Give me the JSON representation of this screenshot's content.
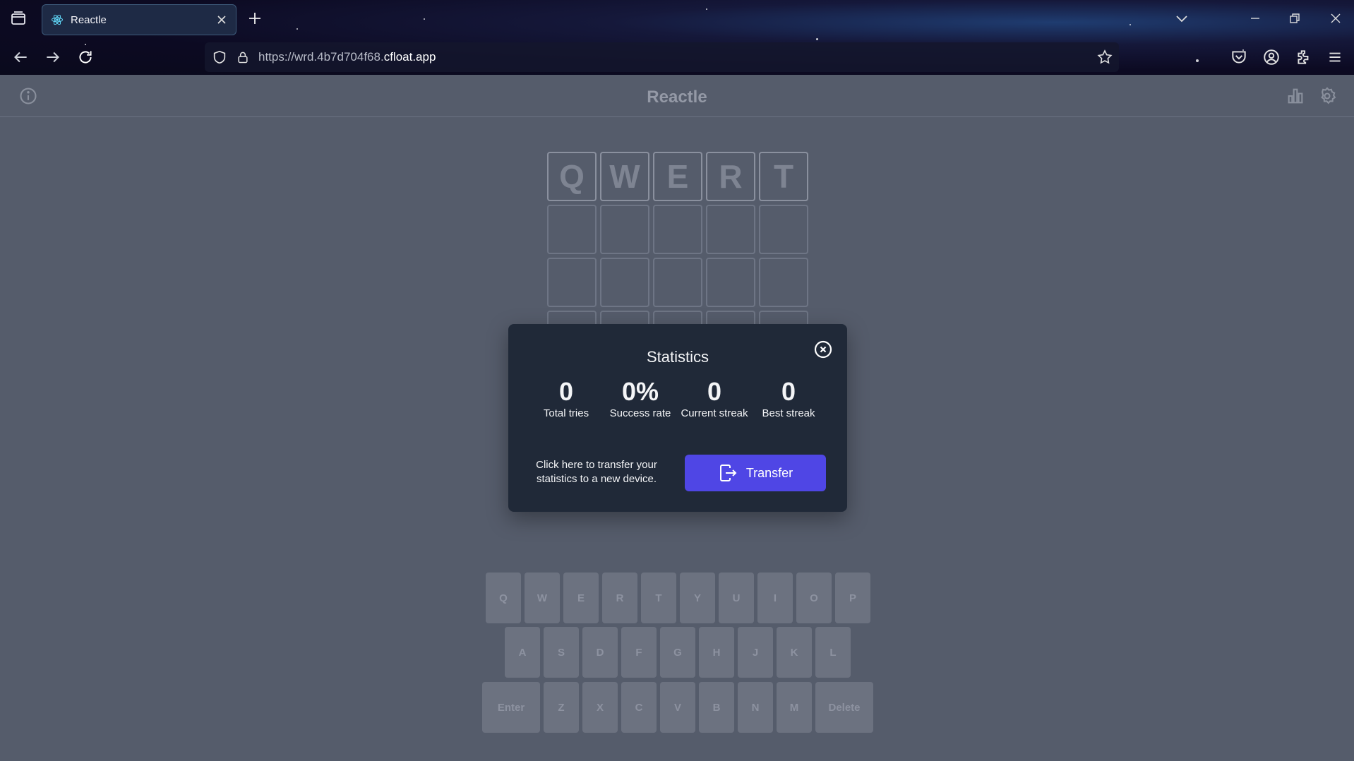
{
  "browser": {
    "tab_title": "Reactle",
    "url_prefix": "https://wrd.4b7d704f68.",
    "url_domain": "cfloat.app"
  },
  "app": {
    "title": "Reactle"
  },
  "grid": {
    "rows": [
      [
        "Q",
        "W",
        "E",
        "R",
        "T"
      ],
      [
        "",
        "",
        "",
        "",
        ""
      ],
      [
        "",
        "",
        "",
        "",
        ""
      ],
      [
        "",
        "",
        "",
        "",
        ""
      ]
    ]
  },
  "keyboard": {
    "row1": [
      "Q",
      "W",
      "E",
      "R",
      "T",
      "Y",
      "U",
      "I",
      "O",
      "P"
    ],
    "row2": [
      "A",
      "S",
      "D",
      "F",
      "G",
      "H",
      "J",
      "K",
      "L"
    ],
    "row3": [
      "Enter",
      "Z",
      "X",
      "C",
      "V",
      "B",
      "N",
      "M",
      "Delete"
    ]
  },
  "modal": {
    "title": "Statistics",
    "stats": [
      {
        "value": "0",
        "label": "Total tries"
      },
      {
        "value": "0%",
        "label": "Success rate"
      },
      {
        "value": "0",
        "label": "Current streak"
      },
      {
        "value": "0",
        "label": "Best streak"
      }
    ],
    "transfer_text": "Click here to transfer your statistics to a new device.",
    "transfer_button": "Transfer"
  },
  "colors": {
    "background": "#555c6b",
    "modal": "#202938",
    "accent": "#4f46e5"
  }
}
